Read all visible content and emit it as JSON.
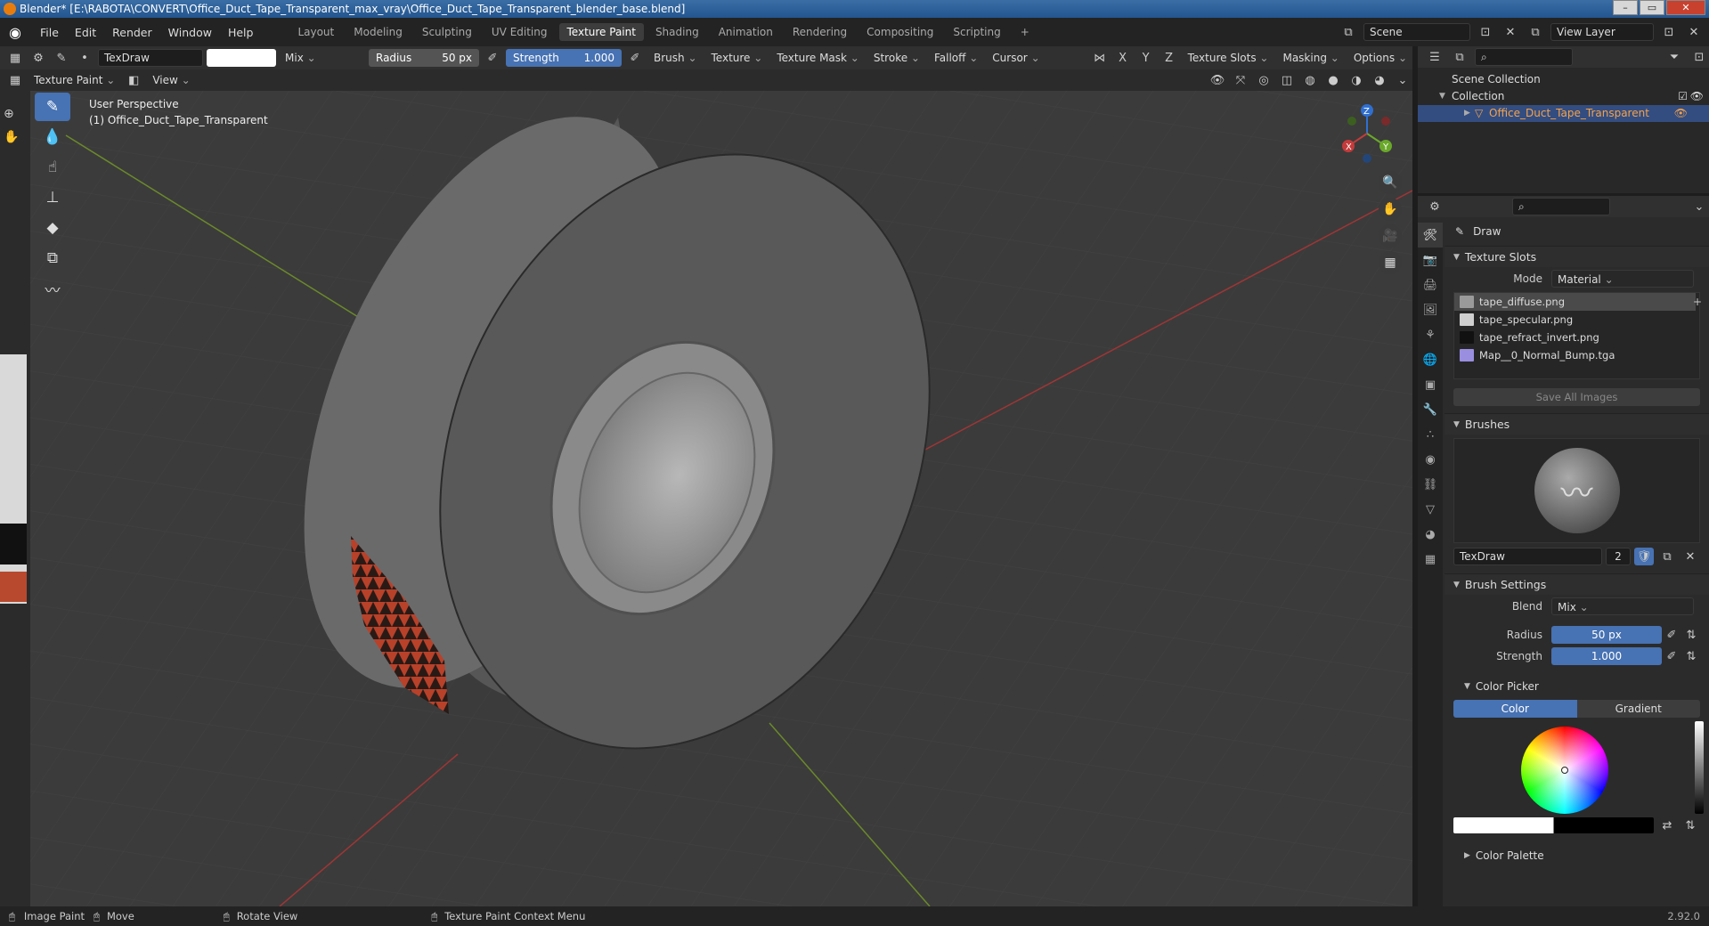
{
  "window": {
    "title": "Blender* [E:\\RABOTA\\CONVERT\\Office_Duct_Tape_Transparent_max_vray\\Office_Duct_Tape_Transparent_blender_base.blend]"
  },
  "menu": [
    "File",
    "Edit",
    "Render",
    "Window",
    "Help"
  ],
  "workspaces": [
    {
      "label": "Layout"
    },
    {
      "label": "Modeling"
    },
    {
      "label": "Sculpting"
    },
    {
      "label": "UV Editing"
    },
    {
      "label": "Texture Paint",
      "active": true
    },
    {
      "label": "Shading"
    },
    {
      "label": "Animation"
    },
    {
      "label": "Rendering"
    },
    {
      "label": "Compositing"
    },
    {
      "label": "Scripting"
    }
  ],
  "scene": {
    "name": "Scene",
    "view_layer": "View Layer"
  },
  "tool_header": {
    "brush_name": "TexDraw",
    "color": "#ffffff",
    "blend": "Mix",
    "radius_label": "Radius",
    "radius_value": "50 px",
    "strength_label": "Strength",
    "strength_value": "1.000",
    "menus": [
      "Brush",
      "Texture",
      "Texture Mask",
      "Stroke",
      "Falloff",
      "Cursor"
    ],
    "axes": [
      "X",
      "Y",
      "Z"
    ],
    "right_menus": [
      "Texture Slots",
      "Masking",
      "Options"
    ]
  },
  "view_header": {
    "mode": "Texture Paint",
    "view": "View"
  },
  "viewport": {
    "line1": "User Perspective",
    "line2": "(1) Office_Duct_Tape_Transparent"
  },
  "gizmo": {
    "x": "X",
    "y": "Y",
    "z": "Z"
  },
  "outliner": {
    "scene_collection": "Scene Collection",
    "collection": "Collection",
    "object": "Office_Duct_Tape_Transparent"
  },
  "properties": {
    "tool_name": "Draw",
    "texture_slots": {
      "title": "Texture Slots",
      "mode_label": "Mode",
      "mode_value": "Material",
      "slots": [
        {
          "name": "tape_diffuse.png",
          "swatch": "#9a9a9a"
        },
        {
          "name": "tape_specular.png",
          "swatch": "#cfcfcf"
        },
        {
          "name": "tape_refract_invert.png",
          "swatch": "#111111"
        },
        {
          "name": "Map__0_Normal_Bump.tga",
          "swatch": "#9a8ee0"
        }
      ],
      "save_button": "Save All Images"
    },
    "brushes": {
      "title": "Brushes",
      "brush_name": "TexDraw",
      "users": "2"
    },
    "brush_settings": {
      "title": "Brush Settings",
      "blend_label": "Blend",
      "blend_value": "Mix",
      "radius_label": "Radius",
      "radius_value": "50 px",
      "strength_label": "Strength",
      "strength_value": "1.000"
    },
    "color_picker": {
      "title": "Color Picker",
      "tab_color": "Color",
      "tab_gradient": "Gradient"
    },
    "color_palette": {
      "title": "Color Palette"
    }
  },
  "statusbar": {
    "left1": "Image Paint",
    "left2": "Move",
    "mid": "Rotate View",
    "ctx": "Texture Paint Context Menu",
    "version": "2.92.0"
  }
}
